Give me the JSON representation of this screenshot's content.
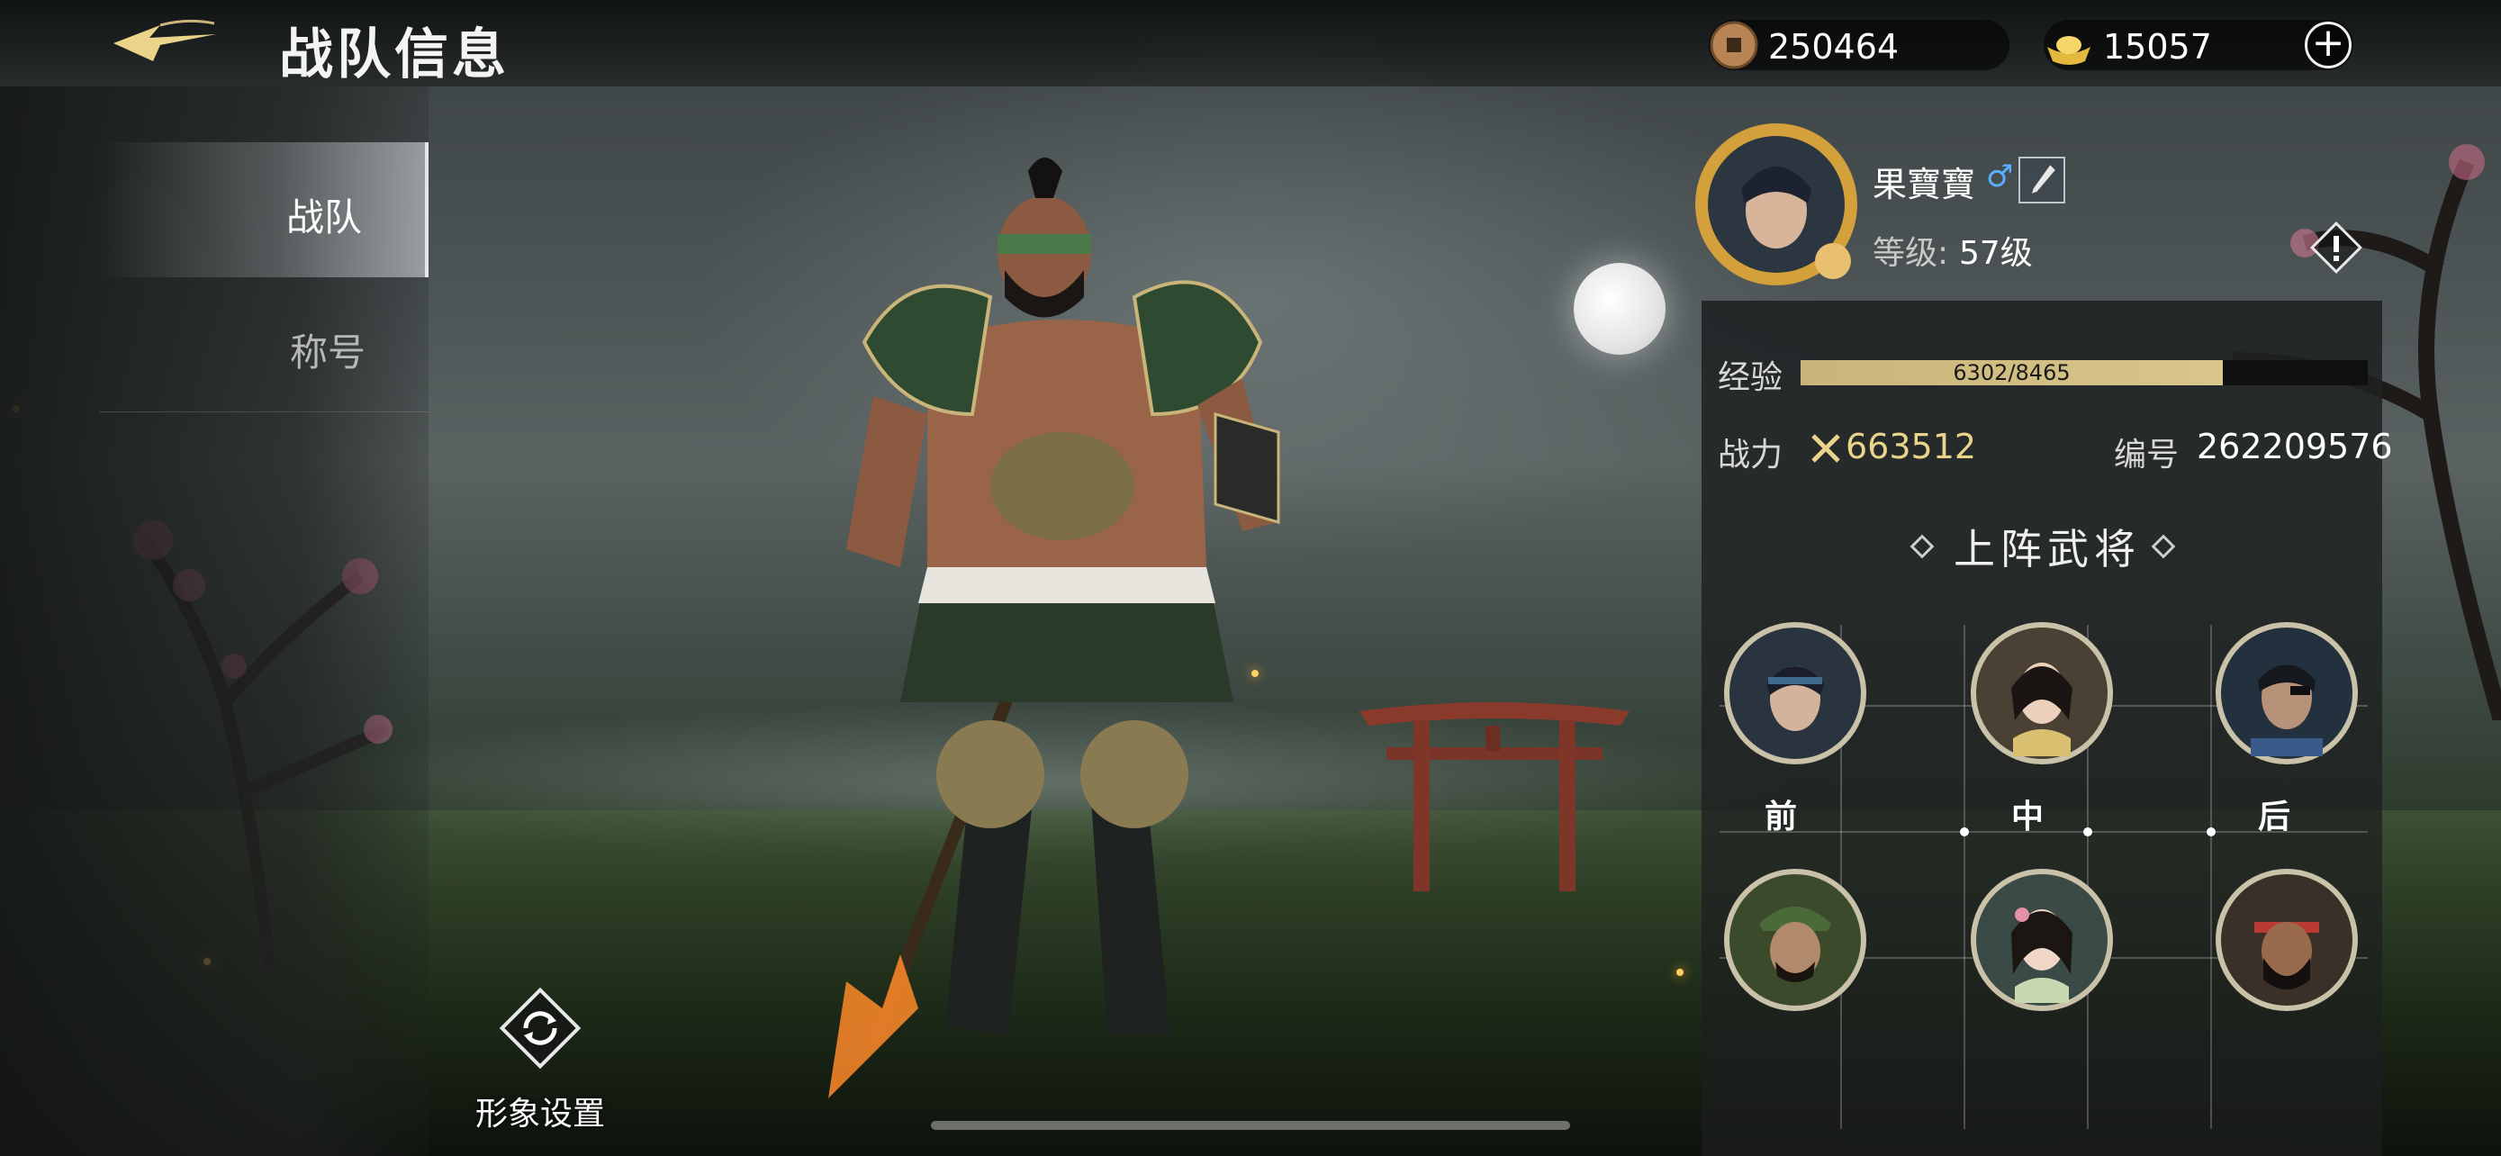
{
  "header": {
    "title": "战队信息",
    "copper_coins": "250464",
    "gold_ingots": "15057"
  },
  "tabs": [
    {
      "label": "战队",
      "selected": true
    },
    {
      "label": "称号",
      "selected": false
    }
  ],
  "appearance": {
    "label": "形象设置"
  },
  "profile": {
    "name": "果寶寶",
    "gender_symbol": "♂",
    "level_label": "等级:",
    "level_value": "57级"
  },
  "stats": {
    "exp_label": "经验",
    "exp_text": "6302/8465",
    "exp_current": 6302,
    "exp_max": 8465,
    "power_label": "战力",
    "power_value": "663512",
    "id_label": "编号",
    "id_value": "262209576"
  },
  "lineup": {
    "title": "上阵武将",
    "rows": [
      "前",
      "中",
      "后"
    ]
  },
  "colors": {
    "accent_gold": "#e9d48a",
    "exp_fill": "#d9c68b",
    "gender_blue": "#5ab0ff"
  },
  "icons": [
    "back-arrow-icon",
    "copper-coin-icon",
    "gold-ingot-icon",
    "plus-icon",
    "edit-brush-icon",
    "alert-icon",
    "crossed-swords-icon",
    "refresh-icon"
  ]
}
